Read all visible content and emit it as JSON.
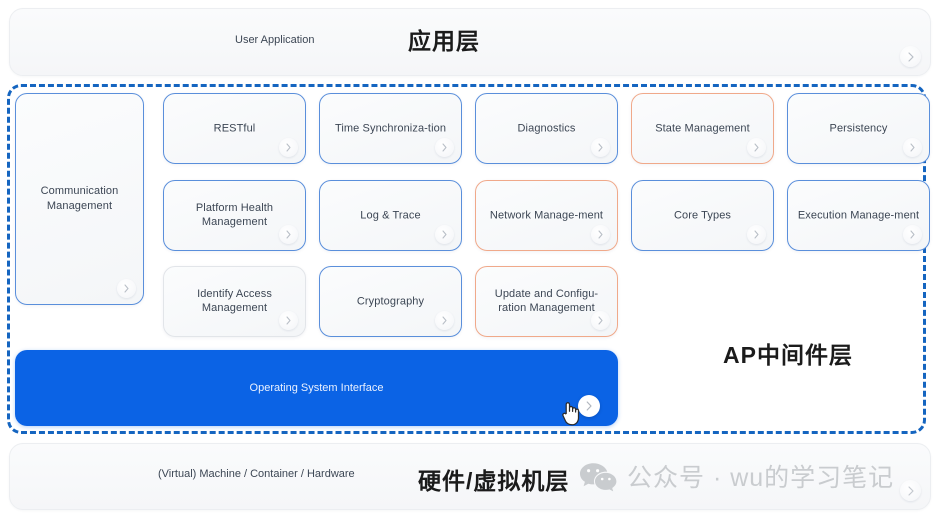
{
  "layers": {
    "application": {
      "en_label": "User Application",
      "cn_label": "应用层"
    },
    "middleware": {
      "cn_label": "AP中间件层",
      "side_card": {
        "label": "Communication Management",
        "border": "blue"
      },
      "cards": [
        {
          "label": "RESTful",
          "border": "blue"
        },
        {
          "label": "Time Synchroniza-tion",
          "border": "blue"
        },
        {
          "label": "Diagnostics",
          "border": "blue"
        },
        {
          "label": "State Management",
          "border": "orange"
        },
        {
          "label": "Persistency",
          "border": "blue"
        },
        {
          "label": "Platform Health Management",
          "border": "blue"
        },
        {
          "label": "Log & Trace",
          "border": "blue"
        },
        {
          "label": "Network Manage-ment",
          "border": "orange"
        },
        {
          "label": "Core Types",
          "border": "blue"
        },
        {
          "label": "Execution Manage-ment",
          "border": "blue"
        },
        {
          "label": "Identify Access Management",
          "border": "grey"
        },
        {
          "label": "Cryptography",
          "border": "blue"
        },
        {
          "label": "Update and Configu-ration Management",
          "border": "orange"
        }
      ],
      "os_interface": {
        "label": "Operating System Interface"
      }
    },
    "hardware": {
      "en_label": "(Virtual) Machine / Container / Hardware",
      "cn_label": "硬件/虚拟机层"
    }
  },
  "watermark": {
    "text": "公众号 · wu的学习笔记"
  },
  "colors": {
    "dashed_border": "#1565c0",
    "os_bar": "#0b63e5",
    "card_blue": "#5a8fdb",
    "card_orange": "#f0a98a",
    "card_grey": "#e2e5e9",
    "text": "#3c4654"
  }
}
